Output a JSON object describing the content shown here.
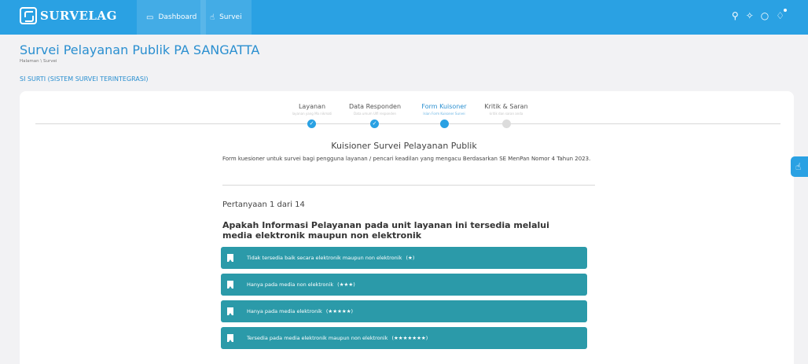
{
  "brand": {
    "name": "SURVELAG"
  },
  "nav": {
    "dashboard": "Dashboard",
    "survei": "Survei"
  },
  "topbar_icons": [
    "search-icon",
    "pin-icon",
    "lightbulb-icon",
    "bell-icon"
  ],
  "page": {
    "title": "Survei Pelayanan Publik PA SANGATTA",
    "breadcrumb": "Halaman \\ Survei",
    "app_label": "SI SURTI (SISTEM SURVEI TERINTEGRASI)"
  },
  "stepper": {
    "steps": [
      {
        "title": "Layanan",
        "sub": "layanan yang Ma nikmati",
        "state": "done"
      },
      {
        "title": "Data Responden",
        "sub": "Data umum Ulfi responden",
        "state": "done"
      },
      {
        "title": "Form Kuisoner",
        "sub": "Isian Form Kuisoner Survei",
        "state": "active"
      },
      {
        "title": "Kritik & Saran",
        "sub": "kritik dan saran anda",
        "state": "pending"
      }
    ]
  },
  "form": {
    "heading": "Kuisioner Survei Pelayanan Publik",
    "description": "Form kuesioner untuk survei bagi pengguna layanan / pencari keadilan yang mengacu Berdasarkan SE MenPan Nomor 4 Tahun 2023.",
    "counter": "Pertanyaan 1 dari 14",
    "question": "Apakah Informasi Pelayanan pada unit layanan ini tersedia melalui media elektronik maupun non elektronik",
    "options": [
      {
        "label": "Tidak tersedia baik secara elektronik maupun non elektronik",
        "stars": "(★)",
        "rating": 1
      },
      {
        "label": "Hanya pada media non elektronik",
        "stars": "(★★★)",
        "rating": 3
      },
      {
        "label": "Hanya pada media elektronik",
        "stars": "(★★★★★)",
        "rating": 5
      },
      {
        "label": "Tersedia pada media elektronik maupun non elektronik",
        "stars": "(★★★★★★★)",
        "rating": 7
      }
    ]
  },
  "colors": {
    "primary": "#2aa1e3",
    "option_bg": "#2b9aa9",
    "title": "#2a8fd0"
  }
}
